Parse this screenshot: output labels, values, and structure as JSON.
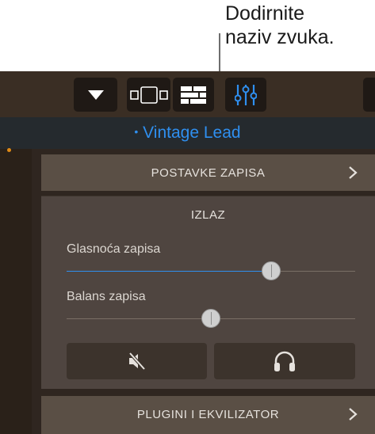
{
  "callout": {
    "line1": "Dodirnite",
    "line2": "naziv zvuka."
  },
  "toolbar": {
    "buttons": [
      {
        "name": "dropdown",
        "icon": "triangle-down-icon"
      },
      {
        "name": "view-switcher",
        "icon": "tracks-view-icon"
      },
      {
        "name": "mixer",
        "icon": "mixer-icon"
      },
      {
        "name": "controls",
        "icon": "sliders-icon",
        "active": true
      }
    ]
  },
  "instrument": {
    "name": "Vintage Lead",
    "name_color": "#2f8fef"
  },
  "sections": {
    "track_settings": "POSTAVKE ZAPISA",
    "output": "IZLAZ",
    "plugins": "PLUGINI I EKVILIZATOR"
  },
  "controls": {
    "volume": {
      "label": "Glasnoća zapisa",
      "level": 0.71
    },
    "pan": {
      "label": "Balans zapisa",
      "level": 0.5
    },
    "mute_icon": "speaker-mute-icon",
    "solo_icon": "headphones-icon"
  }
}
